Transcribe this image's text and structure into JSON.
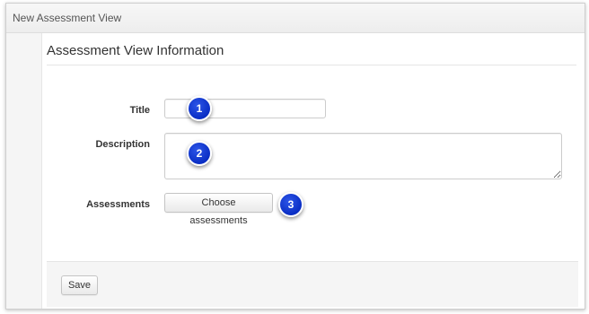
{
  "window": {
    "title": "New Assessment View"
  },
  "section": {
    "heading": "Assessment View Information"
  },
  "form": {
    "title_label": "Title",
    "title_value": "",
    "description_label": "Description",
    "description_value": "",
    "assessments_label": "Assessments",
    "choose_button": "Choose assessments"
  },
  "footer": {
    "save_button": "Save"
  },
  "callouts": [
    "1",
    "2",
    "3"
  ],
  "colors": {
    "callout": "#1033d6",
    "footer_bg": "#f5f5f5",
    "titlebar_bg": "#efefef"
  }
}
